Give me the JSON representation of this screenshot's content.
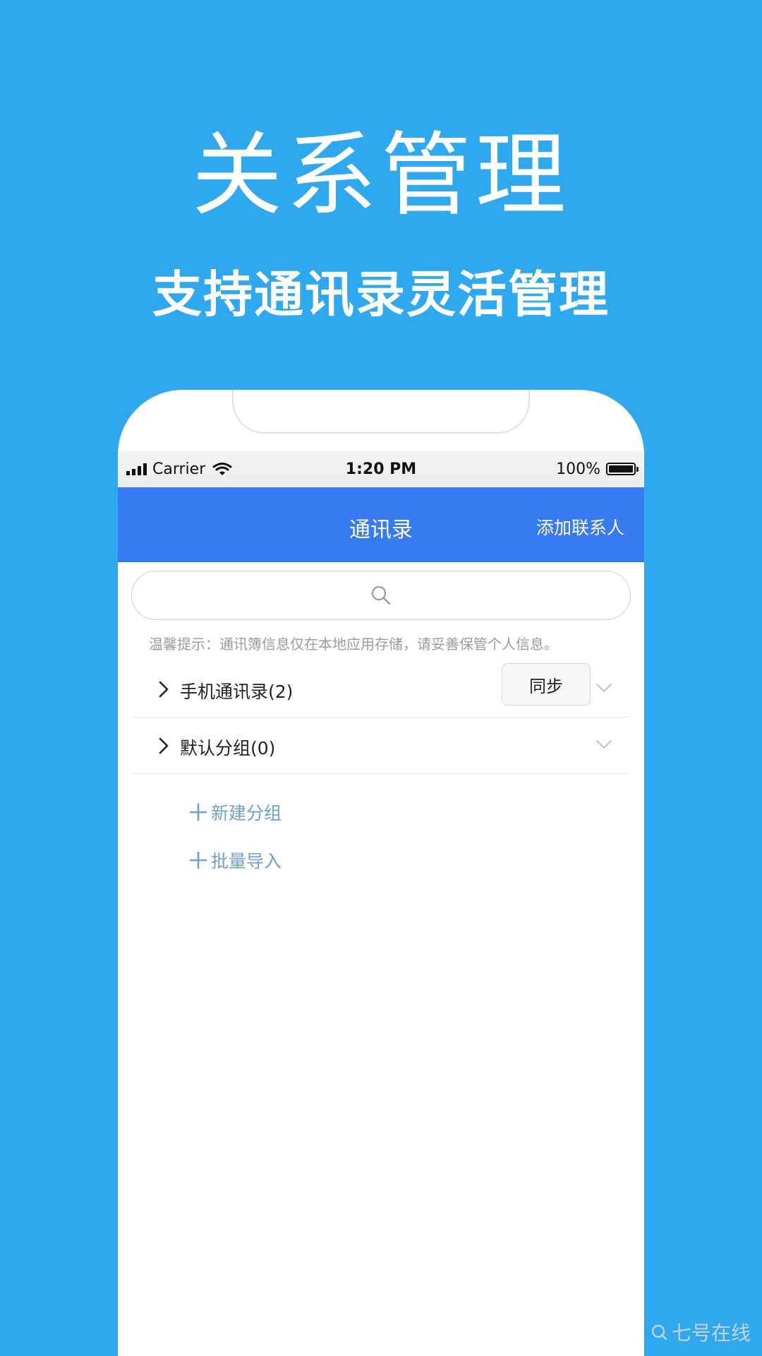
{
  "hero": {
    "title": "关系管理",
    "subtitle": "支持通讯录灵活管理"
  },
  "status_bar": {
    "carrier": "Carrier",
    "time": "1:20 PM",
    "battery": "100%",
    "battery_level": 1.0
  },
  "navbar": {
    "title": "通讯录",
    "action": "添加联系人"
  },
  "search": {
    "icon": "search-icon"
  },
  "tip": "温馨提示：通讯簿信息仅在本地应用存储，请妥善保管个人信息。",
  "groups": [
    {
      "label": "手机通讯录(2)",
      "button": "同步"
    },
    {
      "label": "默认分组(0)"
    }
  ],
  "actions": [
    {
      "label": "新建分组"
    },
    {
      "label": "批量导入"
    }
  ],
  "watermark": "七号在线",
  "colors": {
    "background": "#2ea8ef",
    "navbar": "#367bf2",
    "link": "#6da0ca"
  }
}
